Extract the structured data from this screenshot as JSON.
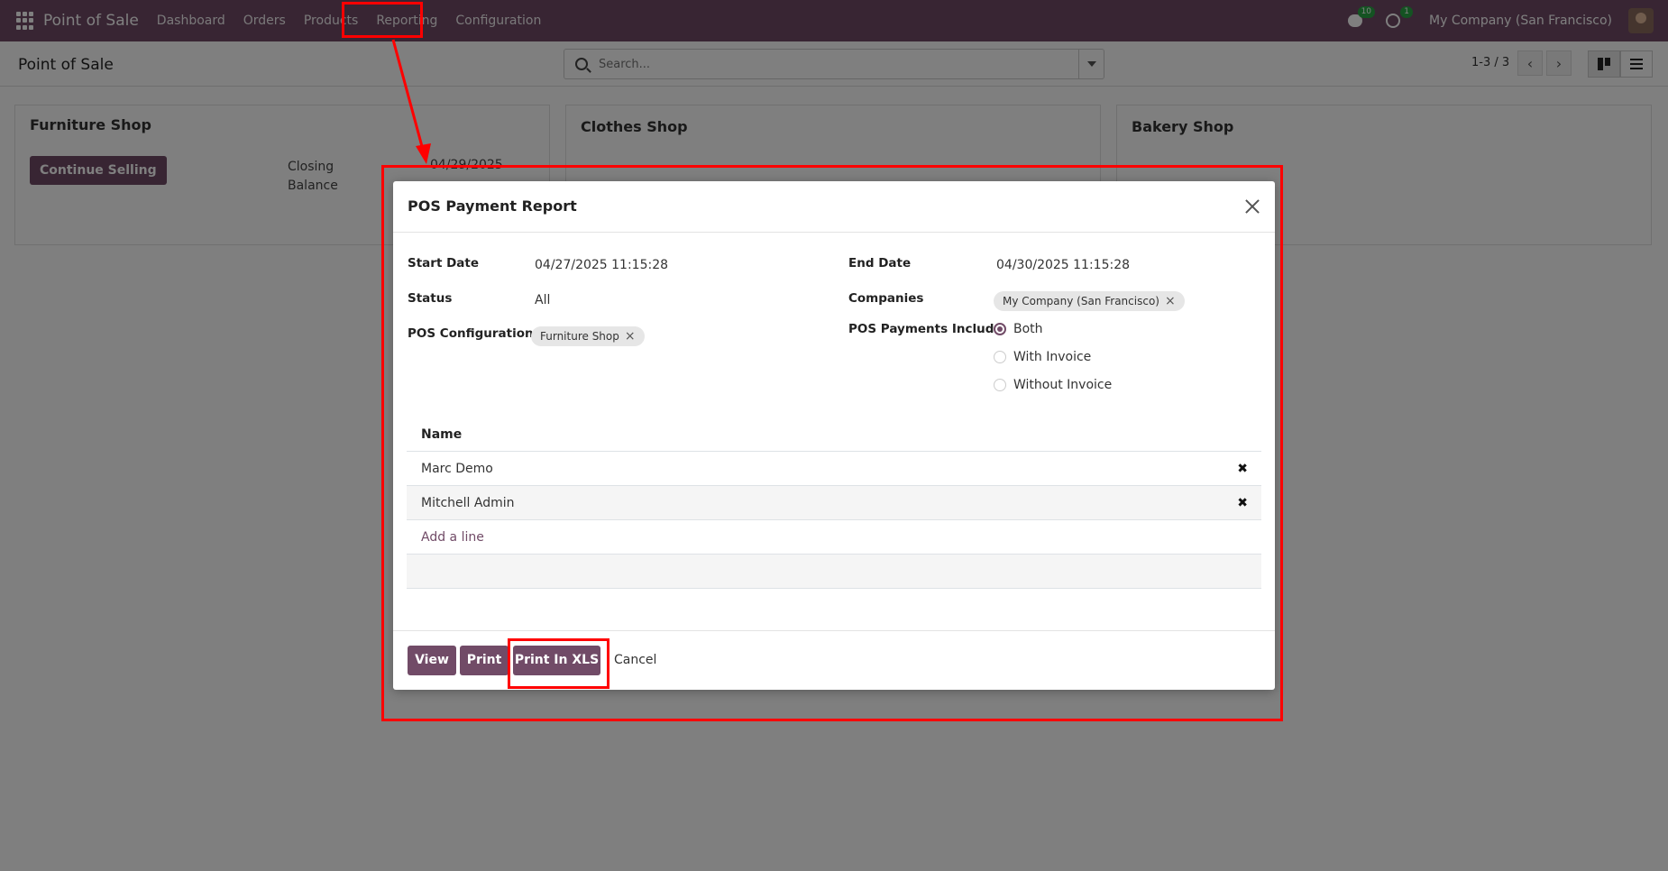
{
  "navbar": {
    "app_name": "Point of Sale",
    "menu": [
      "Dashboard",
      "Orders",
      "Products",
      "Reporting",
      "Configuration"
    ],
    "messages_count": "10",
    "activities_count": "1",
    "company": "My Company (San Francisco)"
  },
  "control_panel": {
    "title": "Point of Sale",
    "search_placeholder": "Search...",
    "pager": "1-3 / 3"
  },
  "cards": [
    {
      "title": "Furniture Shop",
      "button": "Continue Selling",
      "closing_label": "Closing Balance",
      "closing_date": "04/29/2025"
    },
    {
      "title": "Clothes Shop"
    },
    {
      "title": "Bakery Shop"
    }
  ],
  "dialog": {
    "title": "POS Payment Report",
    "start_date_label": "Start Date",
    "start_date": "04/27/2025 11:15:28",
    "end_date_label": "End Date",
    "end_date": "04/30/2025 11:15:28",
    "status_label": "Status",
    "status": "All",
    "companies_label": "Companies",
    "company_tag": "My Company (San Francisco)",
    "pos_config_label": "POS Configuration",
    "pos_config_tag": "Furniture Shop",
    "payments_include_label": "POS Payments Include",
    "payment_options": [
      "Both",
      "With Invoice",
      "Without Invoice"
    ],
    "payment_selected": "Both",
    "table_header": "Name",
    "rows": [
      "Marc Demo",
      "Mitchell Admin"
    ],
    "add_line": "Add a line",
    "buttons": {
      "view": "View",
      "print": "Print",
      "print_xls": "Print In XLS",
      "cancel": "Cancel"
    }
  },
  "colors": {
    "brand": "#714b67",
    "annotation": "#ff0000"
  }
}
